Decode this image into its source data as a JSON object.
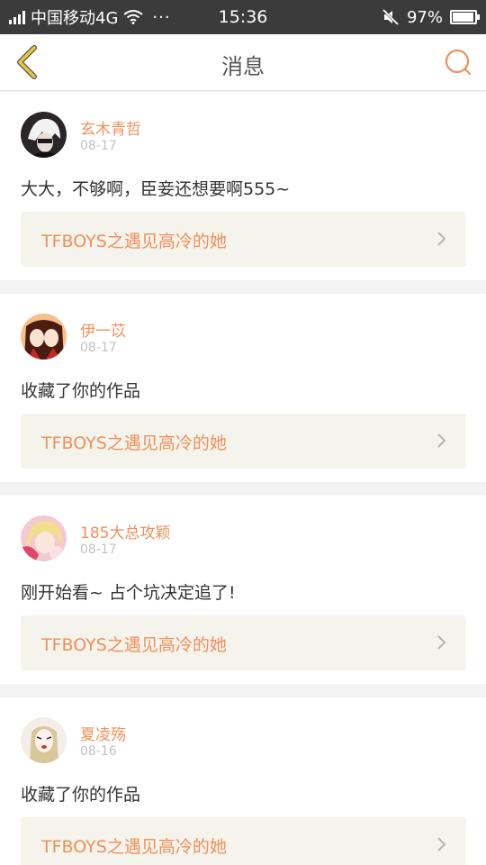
{
  "status_bar": {
    "carrier": "中国移动4G",
    "dots": "···",
    "time": "15:36",
    "battery": "97%",
    "battery_level": 0.97
  },
  "header": {
    "title": "消息",
    "back_icon": "chevron-left-icon",
    "search_icon": "search-icon"
  },
  "colors": {
    "accent": "#f0915a",
    "back_arrow": "#e8c53a",
    "link_background": "#f4f3ec"
  },
  "messages": [
    {
      "username": "玄木青哲",
      "date": "08-17",
      "comment": "大大，不够啊，臣妾还想要啊555~",
      "work_title": "TFBOYS之遇见高冷的她"
    },
    {
      "username": "伊一苡",
      "date": "08-17",
      "comment": "收藏了你的作品",
      "work_title": "TFBOYS之遇见高冷的她"
    },
    {
      "username": "185大总攻颖",
      "date": "08-17",
      "comment": "刚开始看~ 占个坑决定追了!",
      "work_title": "TFBOYS之遇见高冷的她"
    },
    {
      "username": "夏凌殇",
      "date": "08-16",
      "comment": "收藏了你的作品",
      "work_title": "TFBOYS之遇见高冷的她"
    }
  ]
}
